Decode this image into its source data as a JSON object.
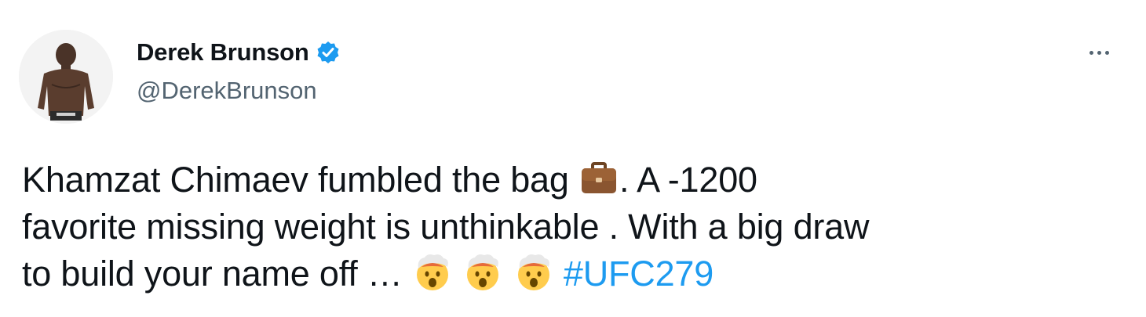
{
  "tweet": {
    "author": {
      "display_name": "Derek Brunson",
      "handle": "@DerekBrunson",
      "verified_icon": "verified-badge-icon",
      "avatar_icon": "avatar"
    },
    "more_icon": "more-options-icon",
    "text": {
      "line1_a": "Khamzat Chimaev fumbled the bag ",
      "line1_emoji": "💼",
      "line1_b": ". A -1200",
      "line2": "favorite missing weight is unthinkable . With a big draw",
      "line3_a": "to build your name off … ",
      "line3_emoji": "🤯",
      "hashtag": "#UFC279"
    },
    "colors": {
      "text": "#0f1419",
      "secondary": "#536471",
      "accent": "#1d9bf0"
    }
  }
}
